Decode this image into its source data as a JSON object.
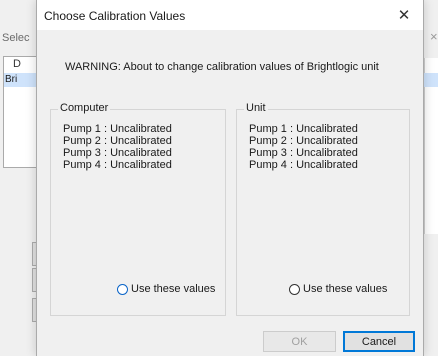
{
  "parent": {
    "title_fragment": "Selec",
    "list_header": "D",
    "list_row": "Bri",
    "close_glyph": "×"
  },
  "dialog": {
    "title": "Choose Calibration Values",
    "close_glyph": "✕",
    "warning": "WARNING:  About to change calibration values of Brightlogic unit",
    "computer_group": {
      "label": "Computer",
      "pumps": [
        "Pump  1 : Uncalibrated",
        "Pump  2 : Uncalibrated",
        "Pump  3 : Uncalibrated",
        "Pump  4 : Uncalibrated"
      ],
      "radio_label": "Use these values",
      "radio_selected": false
    },
    "unit_group": {
      "label": "Unit",
      "pumps": [
        "Pump  1 : Uncalibrated",
        "Pump  2 : Uncalibrated",
        "Pump  3 : Uncalibrated",
        "Pump  4 : Uncalibrated"
      ],
      "radio_label": "Use these values",
      "radio_selected": false
    },
    "ok_label": "OK",
    "ok_enabled": false,
    "cancel_label": "Cancel"
  },
  "colors": {
    "dialog_bg": "#f0f0f0",
    "focus_blue": "#0078d7",
    "selection": "#cfe3fb"
  }
}
